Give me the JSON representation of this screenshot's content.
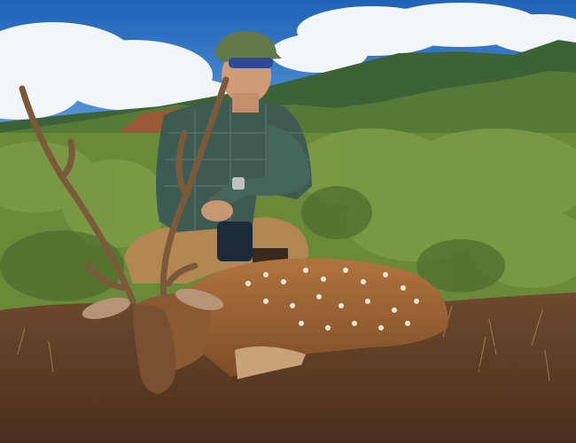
{
  "photo": {
    "subject": "hunter-with-axis-deer",
    "colors": {
      "sky": "#2f78c8",
      "cloud": "#f4f7fb",
      "hill_far": "#3f6a3c",
      "hill_near": "#5c7f3a",
      "brush": "#6f8f3e",
      "dirt": "#7a4a2c",
      "deer_coat": "#9b6434",
      "shirt": "#3d5a52",
      "pants": "#b58a55",
      "cap": "#667a4a"
    }
  }
}
